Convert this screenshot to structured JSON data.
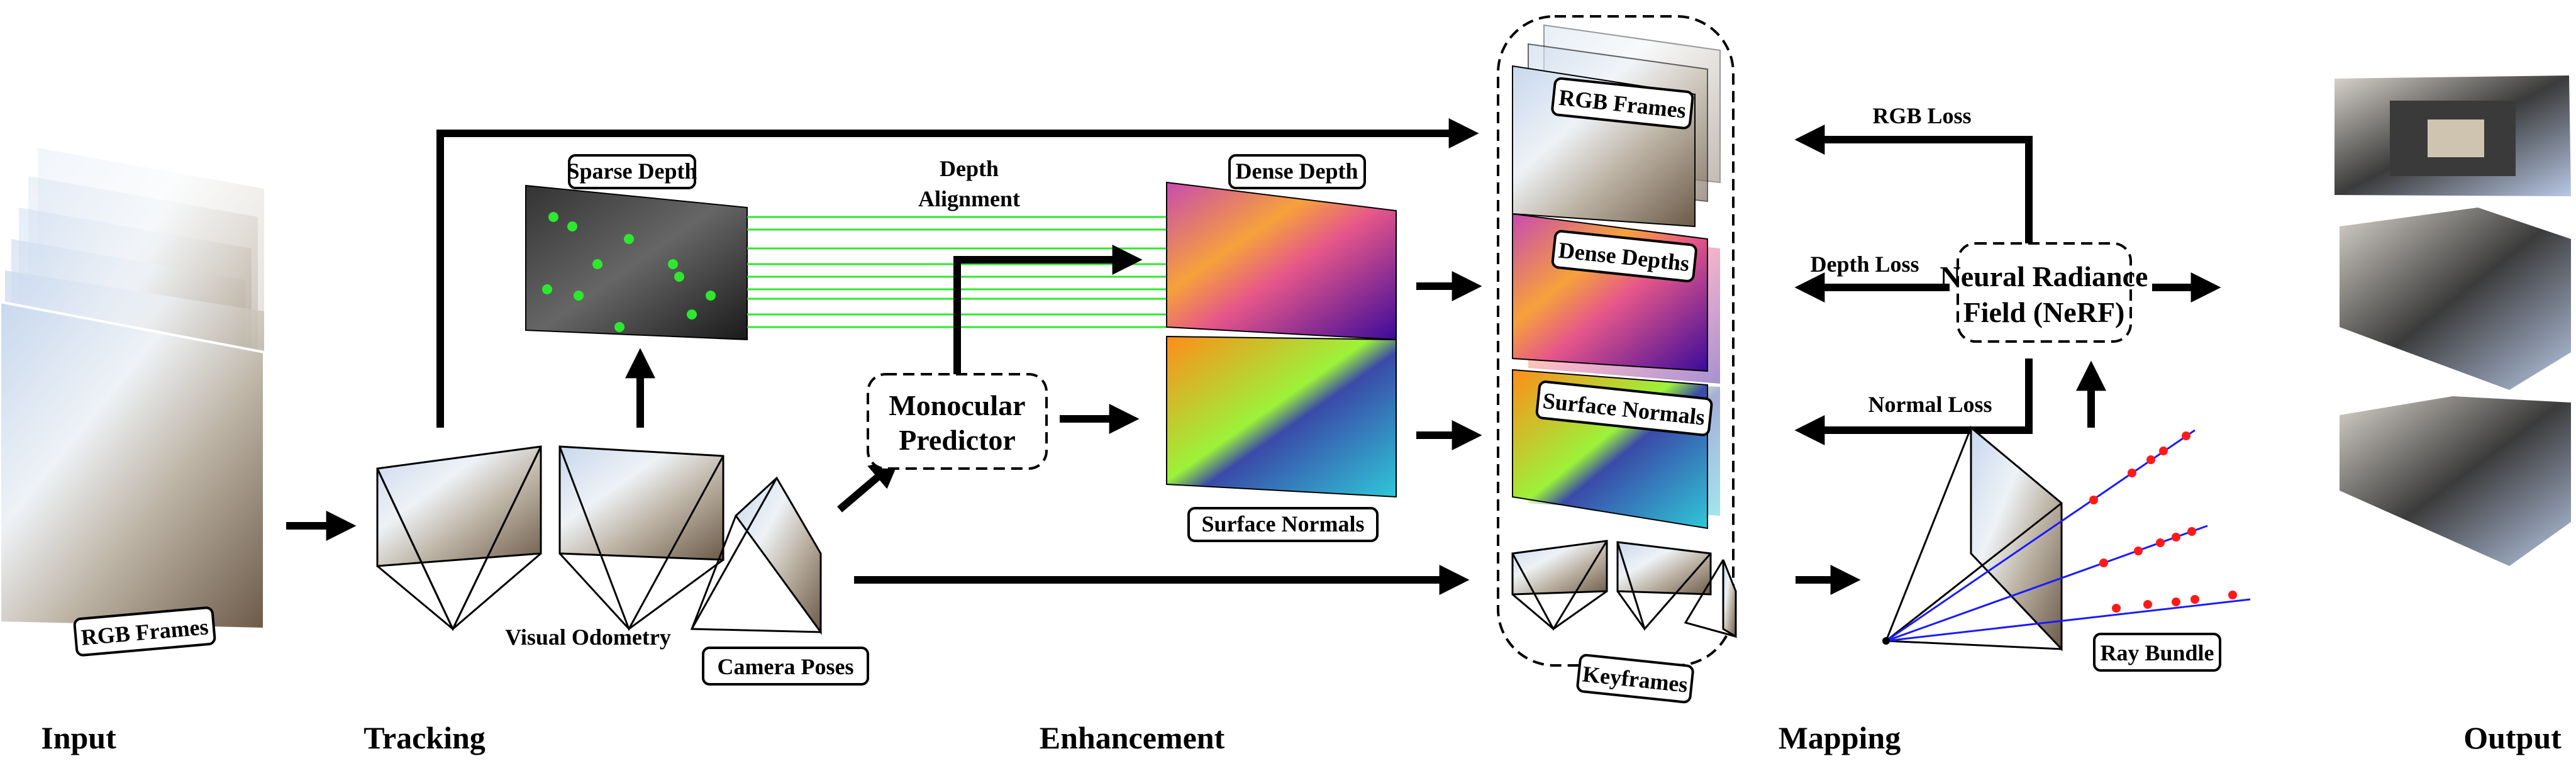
{
  "stages": {
    "input": "Input",
    "tracking": "Tracking",
    "enhancement": "Enhancement",
    "mapping": "Mapping",
    "output": "Output"
  },
  "input": {
    "rgb_frames": "RGB Frames"
  },
  "tracking": {
    "visual_odometry": "Visual Odometry",
    "camera_poses": "Camera Poses",
    "sparse_depth": "Sparse Depth"
  },
  "enhancement": {
    "depth_alignment_line1": "Depth",
    "depth_alignment_line2": "Alignment",
    "monocular_line1": "Monocular",
    "monocular_line2": "Predictor",
    "dense_depth": "Dense Depth",
    "surface_normals": "Surface Normals"
  },
  "mapping": {
    "rgb_frames": "RGB Frames",
    "dense_depths": "Dense Depths",
    "surface_normals": "Surface Normals",
    "keyframes": "Keyframes",
    "rgb_loss": "RGB Loss",
    "depth_loss": "Depth Loss",
    "normal_loss": "Normal Loss",
    "nerf_line1": "Neural Radiance",
    "nerf_line2": "Field (NeRF)",
    "ray_bundle": "Ray Bundle"
  },
  "colors": {
    "alignment_lines": "#2ee82e",
    "rays": "#1a1aff",
    "ray_samples": "#ff1a1a"
  }
}
